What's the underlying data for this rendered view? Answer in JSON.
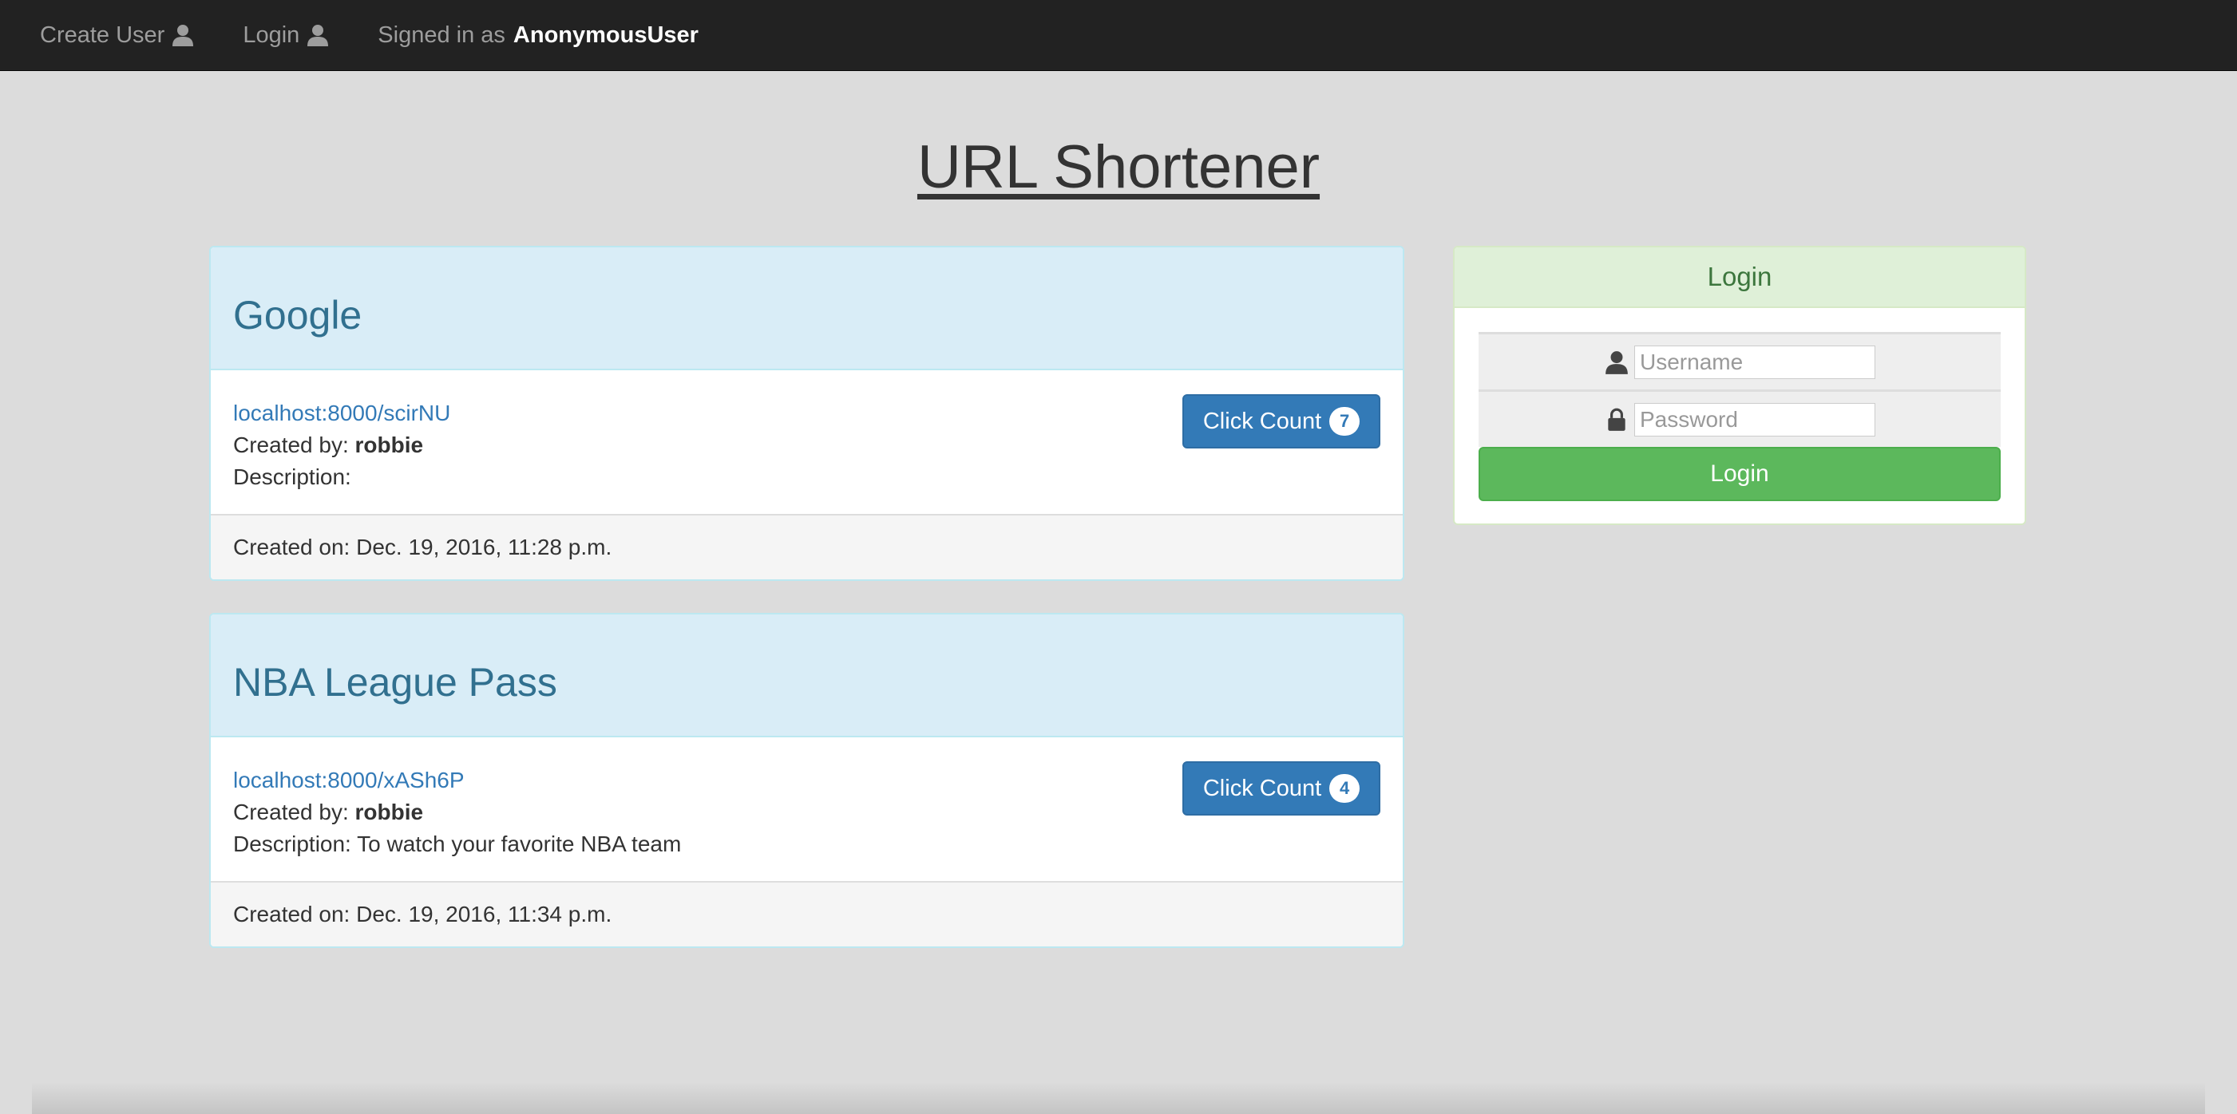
{
  "navbar": {
    "create_user_label": "Create User",
    "login_label": "Login",
    "signed_in_prefix": "Signed in as",
    "signed_in_user": "AnonymousUser"
  },
  "page": {
    "title": "URL Shortener"
  },
  "links": [
    {
      "title": "Google",
      "short_url": "localhost:8000/scirNU",
      "created_by_label": "Created by:",
      "created_by": "robbie",
      "description_label": "Description:",
      "description": "",
      "click_count_label": "Click Count",
      "click_count": "7",
      "created_on": "Created on: Dec. 19, 2016, 11:28 p.m."
    },
    {
      "title": "NBA League Pass",
      "short_url": "localhost:8000/xASh6P",
      "created_by_label": "Created by:",
      "created_by": "robbie",
      "description_label": "Description:",
      "description": "To watch your favorite NBA team",
      "click_count_label": "Click Count",
      "click_count": "4",
      "created_on": "Created on: Dec. 19, 2016, 11:34 p.m."
    }
  ],
  "login_panel": {
    "heading": "Login",
    "username_placeholder": "Username",
    "password_placeholder": "Password",
    "submit_label": "Login"
  },
  "colors": {
    "navbar_bg": "#222222",
    "page_bg": "#dcdcdc",
    "card_header_bg": "#d9edf7",
    "link_color": "#337ab7",
    "primary_button": "#337ab7",
    "success_button": "#5cb85c",
    "login_header_bg": "#dff0d8"
  },
  "icons": {
    "user": "user-icon",
    "lock": "lock-icon"
  }
}
